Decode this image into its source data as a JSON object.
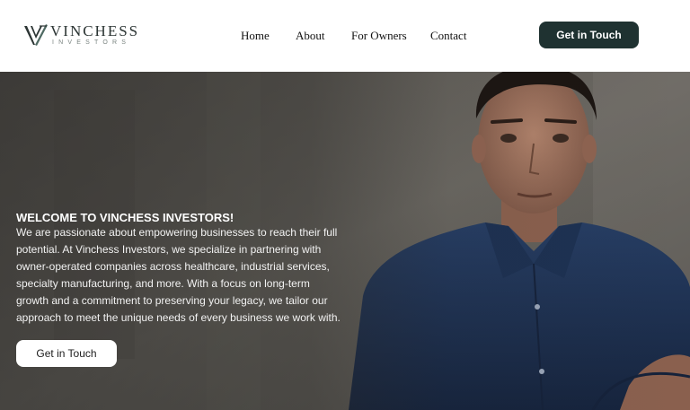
{
  "brand": {
    "name": "VINCHESS",
    "sub": "INVESTORS",
    "logo_icon": "v-monogram-icon"
  },
  "nav": {
    "items": [
      {
        "label": "Home"
      },
      {
        "label": "About"
      },
      {
        "label": "For Owners"
      },
      {
        "label": "Contact"
      }
    ],
    "cta_label": "Get in Touch"
  },
  "hero": {
    "title": "WELCOME TO VINCHESS INVESTORS!",
    "body_lines": [
      "We are passionate about empowering businesses to reach their full",
      "potential. At Vinchess Investors, we specialize in partnering with",
      "owner-operated companies across healthcare, industrial services,",
      "specialty manufacturing, and more. With a focus on long-term",
      "growth and a commitment to preserving your legacy, we tailor our",
      "approach to meet the unique needs of every business we work with."
    ],
    "cta_label": "Get in Touch",
    "image": "portrait-photo"
  },
  "colors": {
    "accent": "#1f3231",
    "hero_text": "#ffffff"
  }
}
